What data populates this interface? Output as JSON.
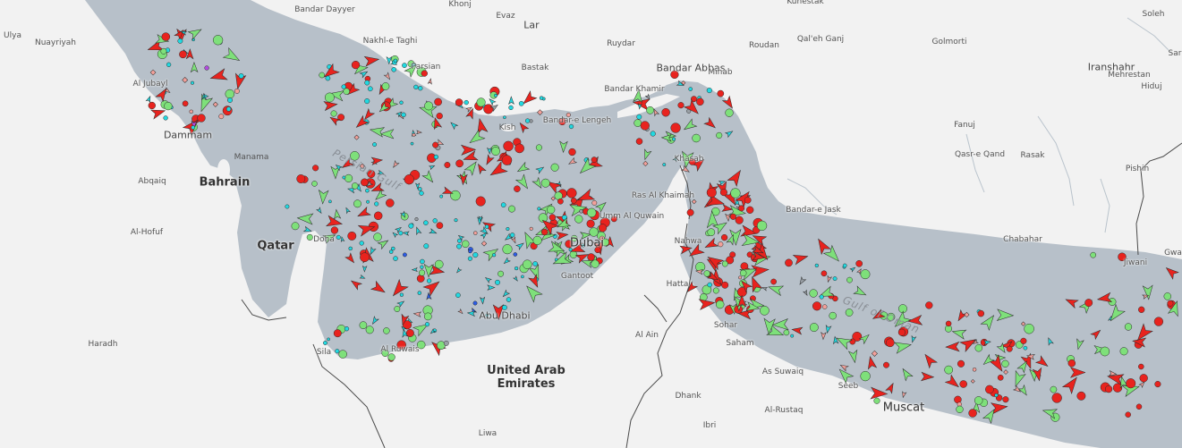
{
  "map": {
    "colors": {
      "water": "#b7c0c9",
      "land": "#f2f2f2",
      "border": "#4a4a4a"
    },
    "place_labels": [
      {
        "text": "Bandar Dayyer",
        "kind": "small",
        "bg": "land"
      },
      {
        "text": "Khonj",
        "kind": "small",
        "bg": "land"
      },
      {
        "text": "Evaz",
        "kind": "small",
        "bg": "land"
      },
      {
        "text": "Lar",
        "kind": "city",
        "bg": "land"
      },
      {
        "text": "Kuhestak",
        "kind": "small",
        "bg": "land"
      },
      {
        "text": "Soleh",
        "kind": "small",
        "bg": "land"
      },
      {
        "text": "Ulya",
        "kind": "small",
        "bg": "land"
      },
      {
        "text": "Nuayriyah",
        "kind": "small",
        "bg": "land"
      },
      {
        "text": "Nakhl-e Taghi",
        "kind": "small",
        "bg": "land"
      },
      {
        "text": "Ruydar",
        "kind": "small",
        "bg": "land"
      },
      {
        "text": "Qal'eh Ganj",
        "kind": "small",
        "bg": "land"
      },
      {
        "text": "Golmorti",
        "kind": "small",
        "bg": "land"
      },
      {
        "text": "Parsian",
        "kind": "small",
        "bg": "land"
      },
      {
        "text": "Bastak",
        "kind": "small",
        "bg": "land"
      },
      {
        "text": "Roudan",
        "kind": "small",
        "bg": "land"
      },
      {
        "text": "Bandar Abbas",
        "kind": "city",
        "bg": "land"
      },
      {
        "text": "Minab",
        "kind": "small",
        "bg": "land"
      },
      {
        "text": "Iranshahr",
        "kind": "city",
        "bg": "land"
      },
      {
        "text": "Mehrestan",
        "kind": "small",
        "bg": "land"
      },
      {
        "text": "Hiduj",
        "kind": "small",
        "bg": "land"
      },
      {
        "text": "Sar",
        "kind": "small",
        "bg": "land"
      },
      {
        "text": "Al Jubayl",
        "kind": "small",
        "bg": "land"
      },
      {
        "text": "Bandar Khamir",
        "kind": "small",
        "bg": "land"
      },
      {
        "text": "Bandar-e Lengeh",
        "kind": "small",
        "bg": "land"
      },
      {
        "text": "Kish",
        "kind": "small",
        "bg": "water"
      },
      {
        "text": "Fanuj",
        "kind": "small",
        "bg": "land"
      },
      {
        "text": "Dammam",
        "kind": "city",
        "bg": "land"
      },
      {
        "text": "Manama",
        "kind": "small",
        "bg": "water"
      },
      {
        "text": "Bahrain",
        "kind": "country",
        "bg": "land"
      },
      {
        "text": "Abqaiq",
        "kind": "small",
        "bg": "land"
      },
      {
        "text": "Khasab",
        "kind": "small",
        "bg": "land"
      },
      {
        "text": "Qasr-e Qand",
        "kind": "small",
        "bg": "land"
      },
      {
        "text": "Rasak",
        "kind": "small",
        "bg": "land"
      },
      {
        "text": "Pishin",
        "kind": "small",
        "bg": "land"
      },
      {
        "text": "Ras Al Khaimah",
        "kind": "small",
        "bg": "land"
      },
      {
        "text": "Bandar-e Jask",
        "kind": "small",
        "bg": "land"
      },
      {
        "text": "Umm Al Quwain",
        "kind": "small",
        "bg": "land"
      },
      {
        "text": "Al-Hofuf",
        "kind": "small",
        "bg": "land"
      },
      {
        "text": "Qatar",
        "kind": "country",
        "bg": "land"
      },
      {
        "text": "Doha",
        "kind": "small",
        "bg": "land"
      },
      {
        "text": "Dubai",
        "kind": "big",
        "bg": "land"
      },
      {
        "text": "Nahwa",
        "kind": "small",
        "bg": "land"
      },
      {
        "text": "Chabahar",
        "kind": "small",
        "bg": "land"
      },
      {
        "text": "Jiwani",
        "kind": "small",
        "bg": "land"
      },
      {
        "text": "Gwa",
        "kind": "small",
        "bg": "land"
      },
      {
        "text": "Gantoot",
        "kind": "small",
        "bg": "land"
      },
      {
        "text": "Hatta",
        "kind": "small",
        "bg": "land"
      },
      {
        "text": "Abu Dhabi",
        "kind": "city",
        "bg": "land"
      },
      {
        "text": "Sohar",
        "kind": "small",
        "bg": "land"
      },
      {
        "text": "Saham",
        "kind": "small",
        "bg": "land"
      },
      {
        "text": "Al Ain",
        "kind": "small",
        "bg": "land"
      },
      {
        "text": "Haradh",
        "kind": "small",
        "bg": "land"
      },
      {
        "text": "Sila",
        "kind": "small",
        "bg": "land"
      },
      {
        "text": "Al Ruwais",
        "kind": "small",
        "bg": "land"
      },
      {
        "text": "As Suwaiq",
        "kind": "small",
        "bg": "land"
      },
      {
        "text": "United Arab\nEmirates",
        "kind": "country",
        "bg": "land"
      },
      {
        "text": "Seeb",
        "kind": "small",
        "bg": "land"
      },
      {
        "text": "Muscat",
        "kind": "big",
        "bg": "land"
      },
      {
        "text": "Dhank",
        "kind": "small",
        "bg": "land"
      },
      {
        "text": "Al-Rustaq",
        "kind": "small",
        "bg": "land"
      },
      {
        "text": "Ibri",
        "kind": "small",
        "bg": "land"
      },
      {
        "text": "Liwa",
        "kind": "small",
        "bg": "land"
      }
    ],
    "water_labels": [
      "Persian Gulf",
      "Gulf of Oman"
    ],
    "marker_legend": {
      "red": "#e8231e",
      "green": "#7ee07a",
      "cyan": "#22d8e0",
      "salmon": "#f2a09a",
      "purple": "#b24be0",
      "blue": "#2b5ce6",
      "yellow": "#f2c12e",
      "grey": "#9aa0a6"
    }
  }
}
